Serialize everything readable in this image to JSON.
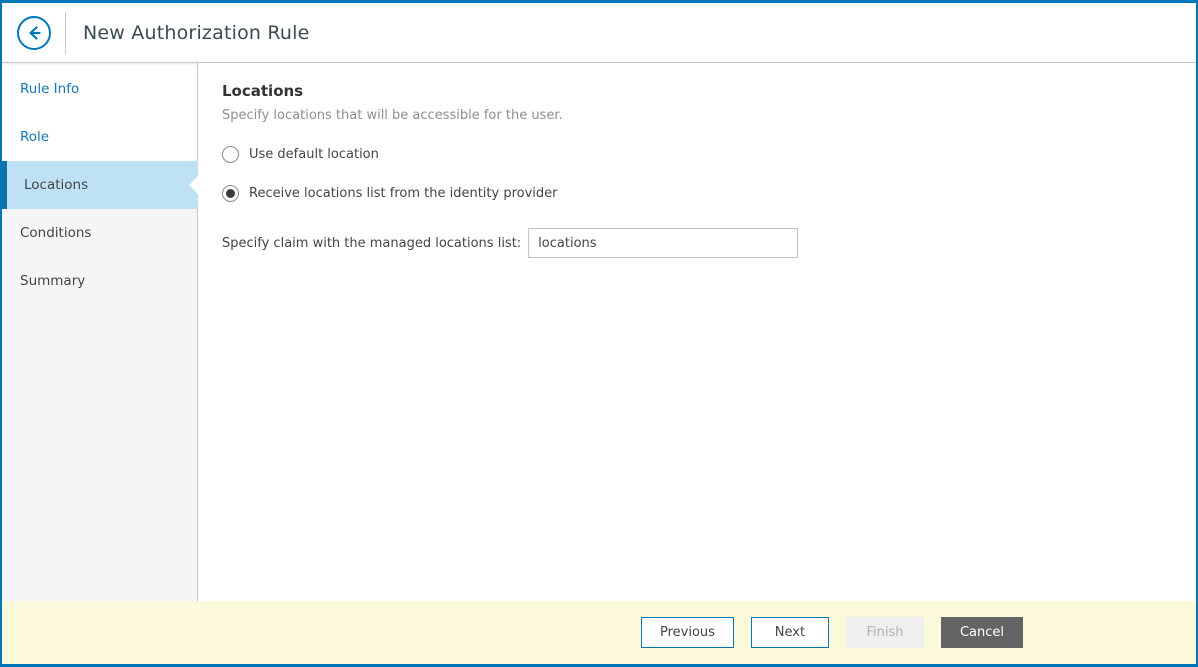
{
  "header": {
    "title": "New Authorization Rule"
  },
  "sidebar": {
    "items": [
      {
        "label": "Rule Info",
        "state": "visited"
      },
      {
        "label": "Role",
        "state": "visited"
      },
      {
        "label": "Locations",
        "state": "active"
      },
      {
        "label": "Conditions",
        "state": "upcoming"
      },
      {
        "label": "Summary",
        "state": "upcoming"
      }
    ]
  },
  "main": {
    "heading": "Locations",
    "description": "Specify locations that will be accessible for the user.",
    "radios": [
      {
        "label": "Use default location",
        "selected": false
      },
      {
        "label": "Receive locations list from the identity provider",
        "selected": true
      }
    ],
    "claim": {
      "label": "Specify claim with the managed locations list:",
      "value": "locations"
    }
  },
  "footer": {
    "buttons": [
      {
        "label": "Previous",
        "style": "outline",
        "enabled": true
      },
      {
        "label": "Next",
        "style": "outline",
        "enabled": true
      },
      {
        "label": "Finish",
        "style": "disabled",
        "enabled": false
      },
      {
        "label": "Cancel",
        "style": "dark",
        "enabled": true
      }
    ]
  },
  "colors": {
    "accent_blue": "#0077b8",
    "link_blue": "#1577b2",
    "active_step_bg": "#bee1f6",
    "active_step_bar": "#1173ae",
    "footer_bg": "#fcf9da",
    "cancel_bg": "#646464"
  }
}
